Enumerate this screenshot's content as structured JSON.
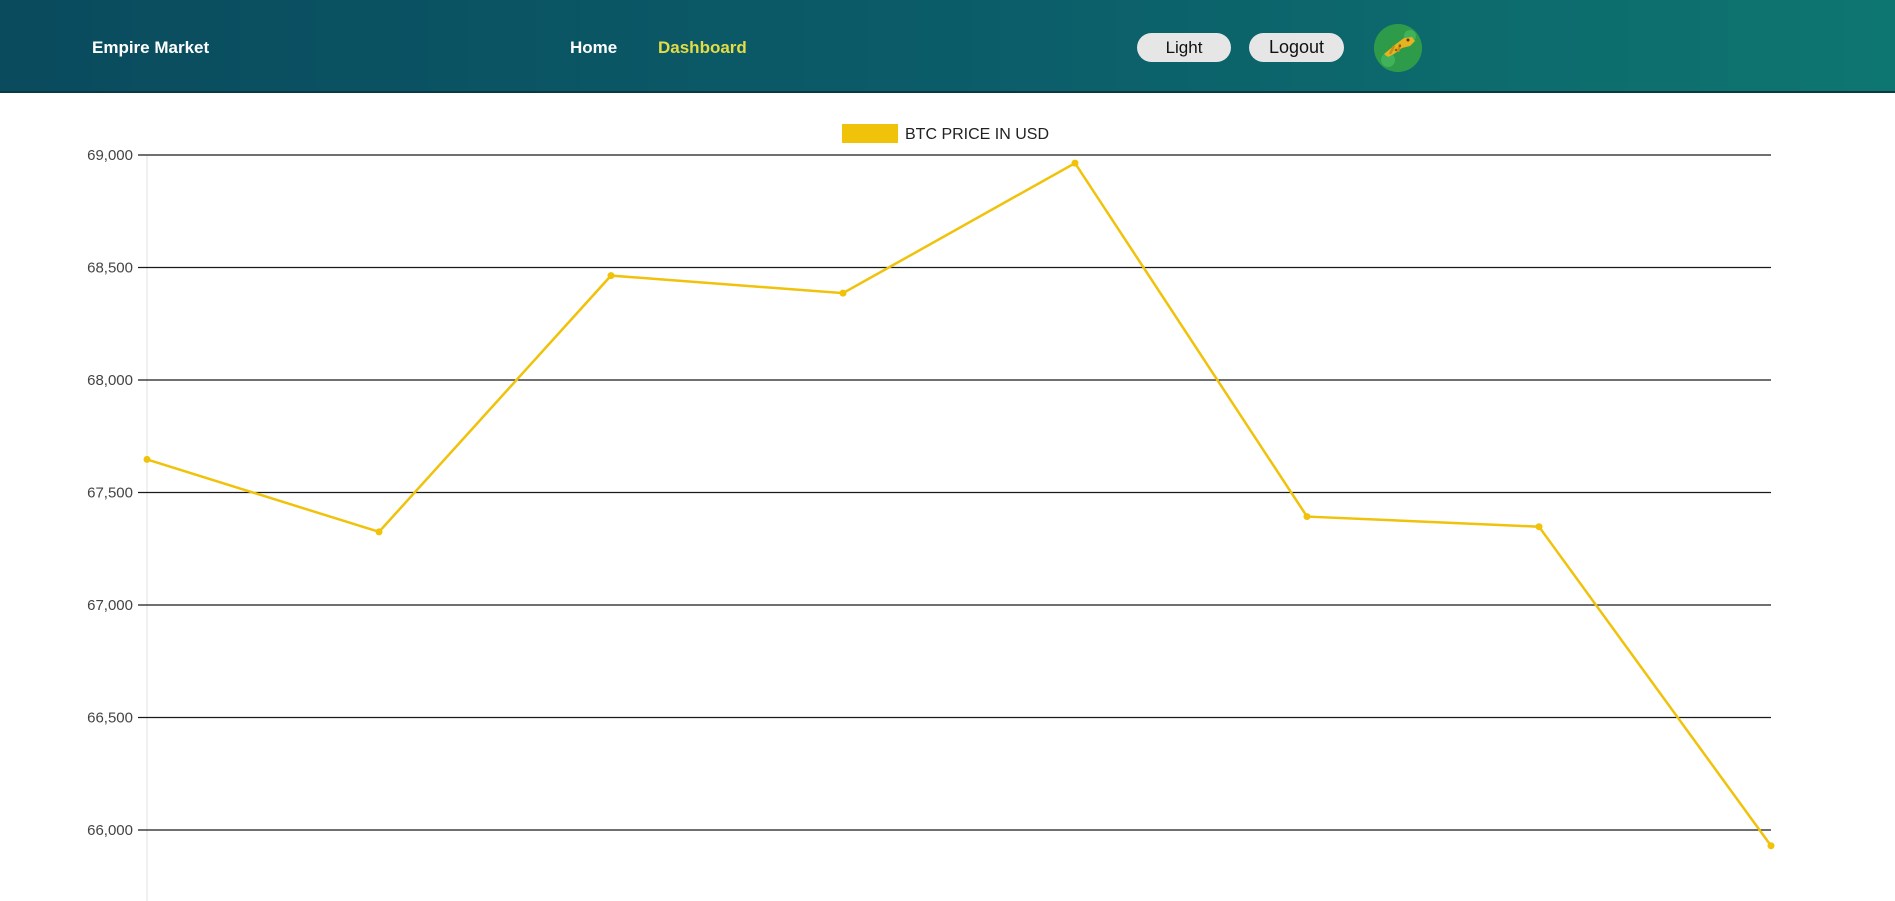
{
  "nav": {
    "brand": "Empire Market",
    "links": [
      {
        "label": "Home",
        "active": false
      },
      {
        "label": "Dashboard",
        "active": true
      }
    ],
    "active_color": "#e4dc45"
  },
  "actions": {
    "theme_label": "Light",
    "logout_label": "Logout"
  },
  "avatar": {
    "icon": "cheetah-avatar-icon"
  },
  "chart_data": {
    "type": "line",
    "title": "",
    "xlabel": "",
    "ylabel": "",
    "series": [
      {
        "name": "BTC PRICE IN USD",
        "color": "#f0c20a",
        "values": [
          67647,
          67325,
          68464,
          68386,
          68964,
          67393,
          67348,
          65930
        ]
      }
    ],
    "yticks": [
      66000,
      66500,
      67000,
      67500,
      68000,
      68500,
      69000
    ],
    "ytick_labels": [
      "66,000",
      "66,500",
      "67,000",
      "67,500",
      "68,000",
      "68,500",
      "69,000"
    ],
    "ylim": [
      65680,
      69000
    ],
    "grid": true,
    "legend_position": "top-center"
  }
}
